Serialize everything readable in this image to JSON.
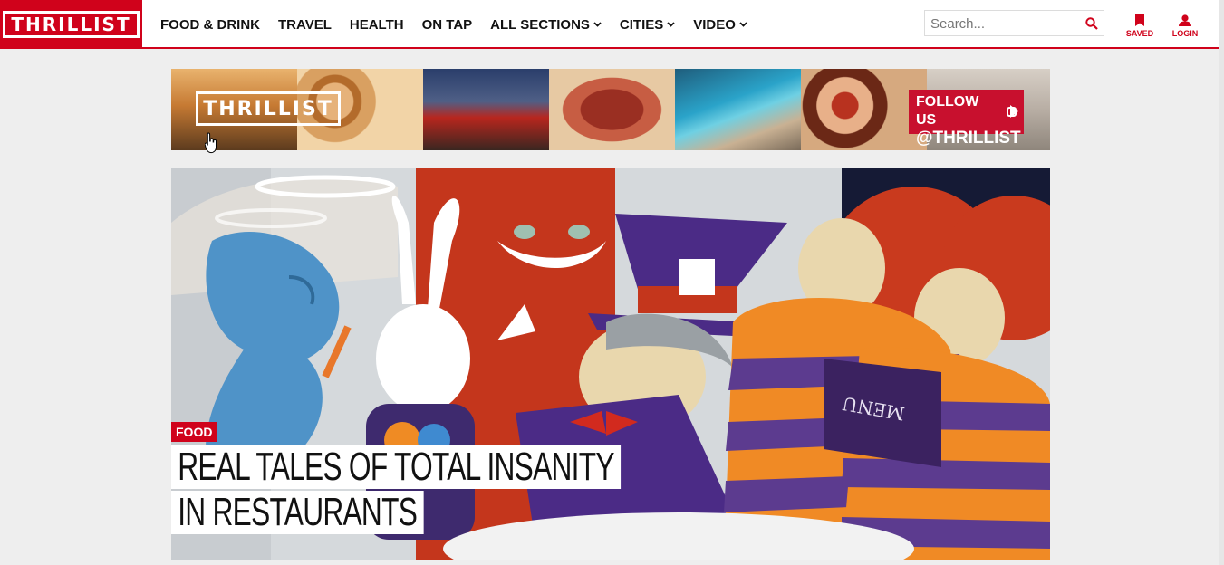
{
  "header": {
    "logo": "THRILLIST",
    "nav": [
      {
        "label": "FOOD & DRINK",
        "dropdown": false
      },
      {
        "label": "TRAVEL",
        "dropdown": false
      },
      {
        "label": "HEALTH",
        "dropdown": false
      },
      {
        "label": "ON TAP",
        "dropdown": false
      },
      {
        "label": "ALL SECTIONS",
        "dropdown": true
      },
      {
        "label": "CITIES",
        "dropdown": true
      },
      {
        "label": "VIDEO",
        "dropdown": true
      }
    ],
    "search": {
      "placeholder": "Search...",
      "icon": "search-icon"
    },
    "saved": {
      "label": "SAVED",
      "icon": "bookmark-icon"
    },
    "login": {
      "label": "LOGIN",
      "icon": "user-icon"
    },
    "accent_color": "#d0021b"
  },
  "banner": {
    "logo": "THRILLIST",
    "follow_line1": "FOLLOW US",
    "follow_line2": "@THRILLIST",
    "icon": "instagram-icon"
  },
  "hero": {
    "tag": "FOOD",
    "headline_line1": "REAL TALES OF TOTAL INSANITY",
    "headline_line2": "IN RESTAURANTS"
  }
}
